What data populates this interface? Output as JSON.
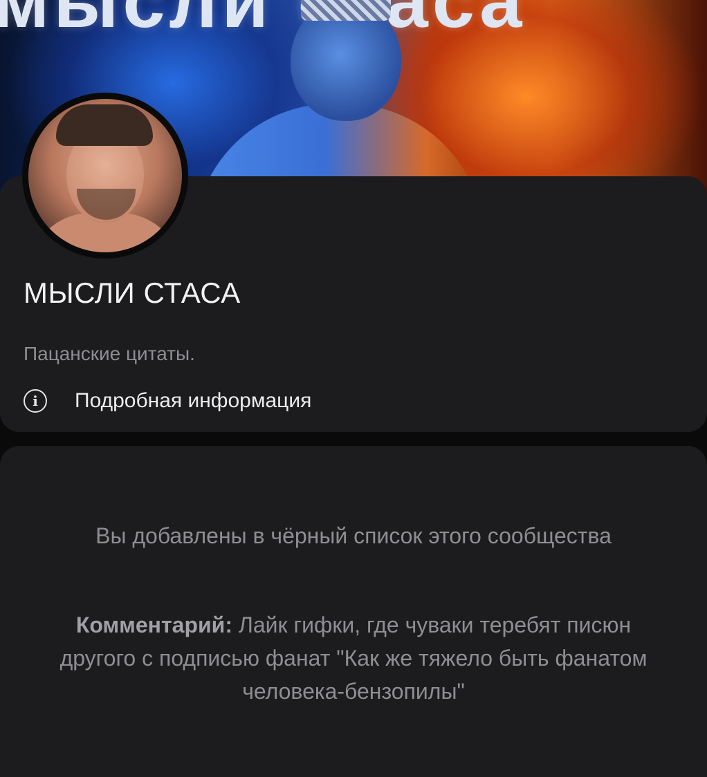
{
  "cover": {
    "title_text": "мысли стаса"
  },
  "community": {
    "name": "МЫСЛИ СТАСА",
    "description": "Пацанские цитаты.",
    "details_link": "Подробная информация",
    "info_icon": "info-icon"
  },
  "blocked": {
    "message": "Вы добавлены в чёрный список этого сообщества",
    "comment_label": "Комментарий:",
    "comment_text": " Лайк гифки, где чуваки теребят писюн другого с подписью фанат \"Как же тяжело быть фанатом человека-бензопилы\""
  }
}
